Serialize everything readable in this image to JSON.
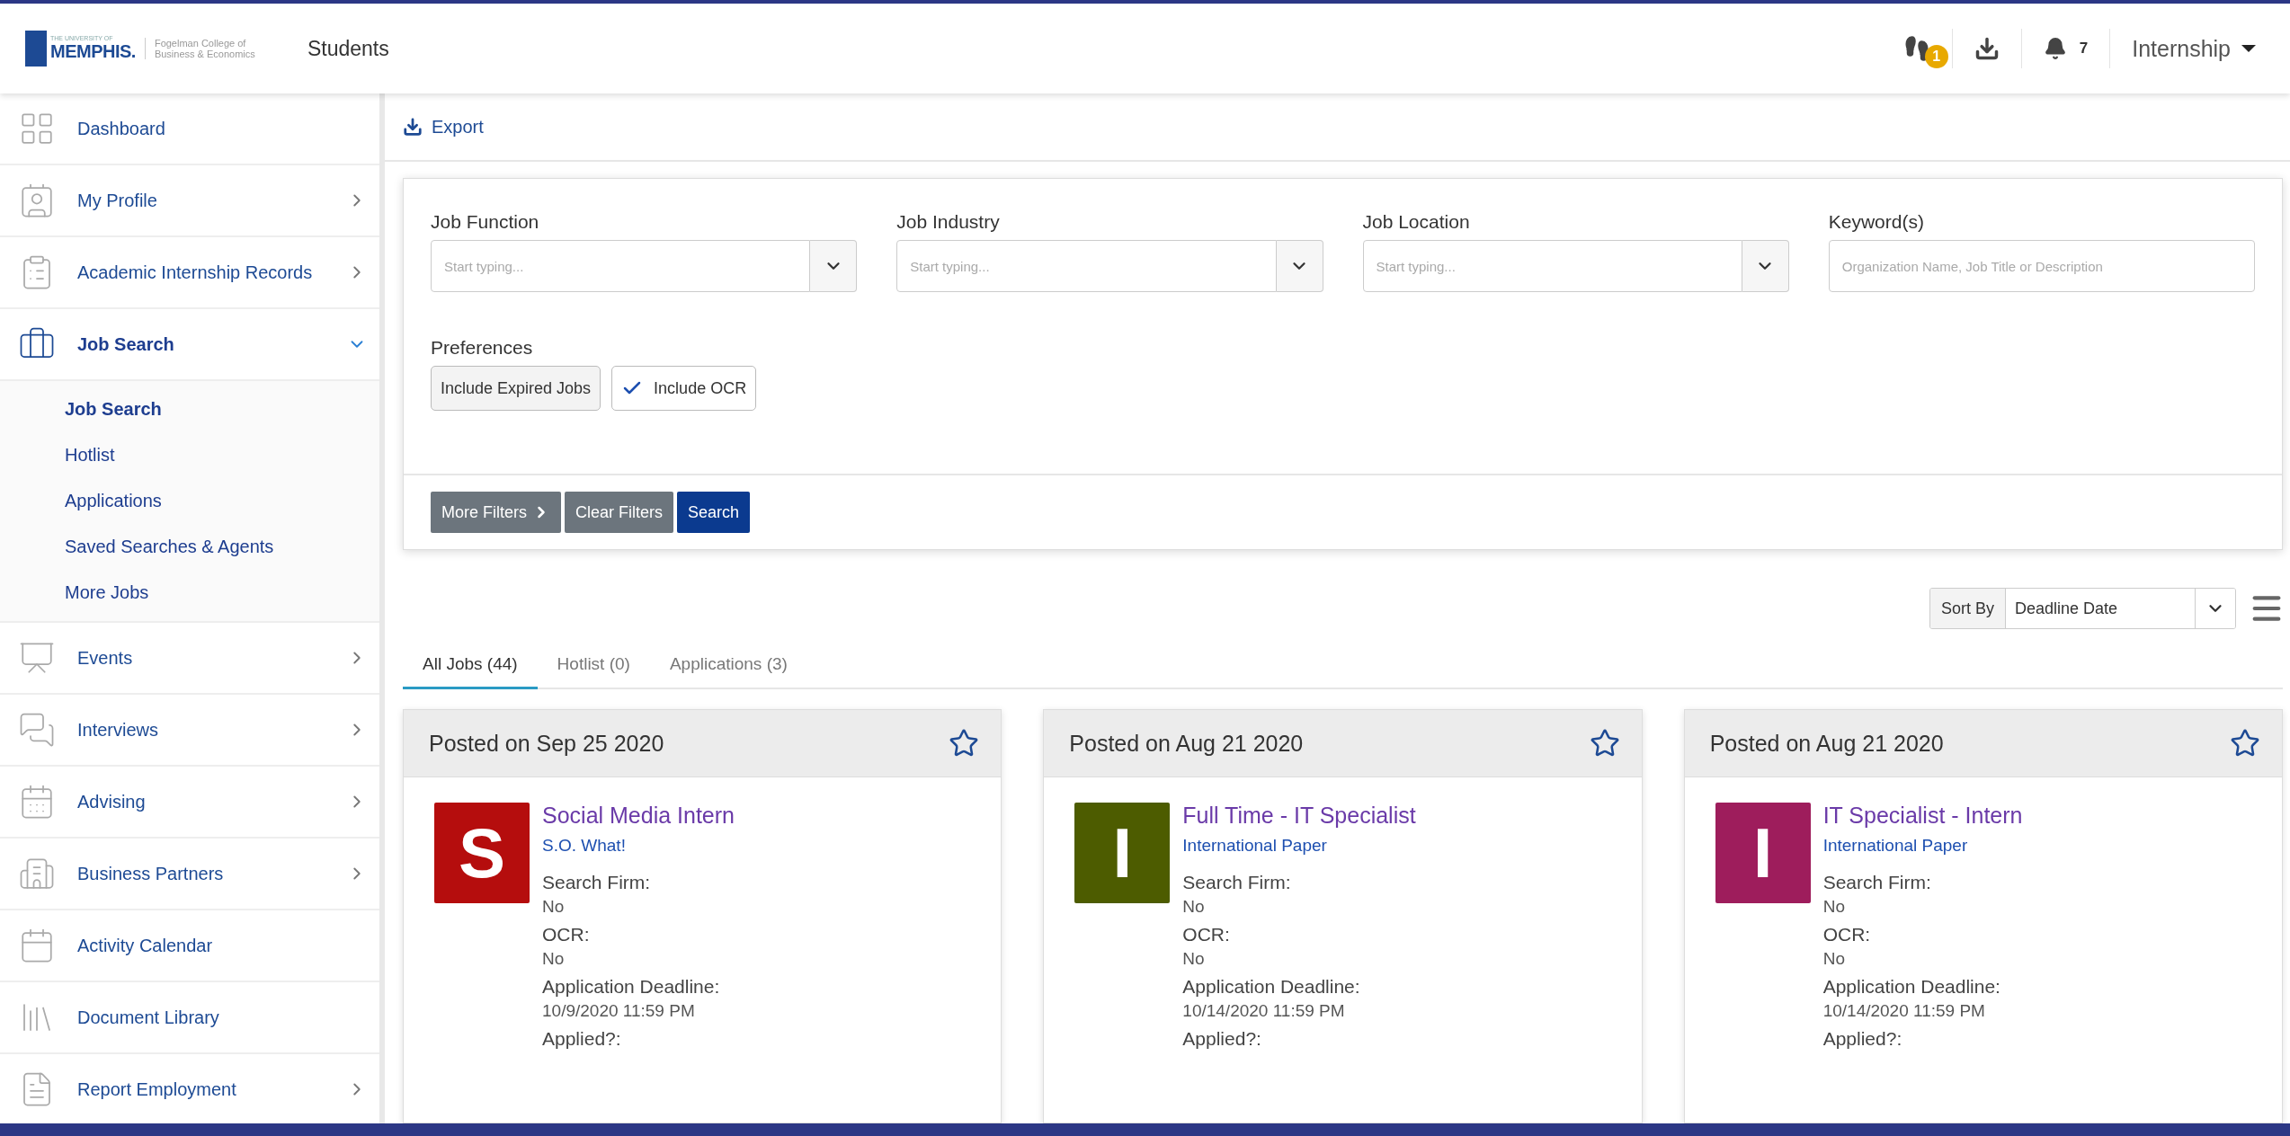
{
  "header": {
    "logo_small": "THE UNIVERSITY OF",
    "logo_main": "MEMPHIS.",
    "college": "Fogelman College of Business & Economics",
    "section": "Students",
    "badge_count": "1",
    "notification_count": "7",
    "role_menu": "Internship"
  },
  "sidebar": {
    "items": [
      {
        "label": "Dashboard",
        "kind": "link"
      },
      {
        "label": "My Profile",
        "kind": "group",
        "expanded": false
      },
      {
        "label": "Academic Internship Records",
        "kind": "group",
        "expanded": false
      },
      {
        "label": "Job Search",
        "kind": "group",
        "expanded": true,
        "children": [
          {
            "label": "Job Search",
            "selected": true
          },
          {
            "label": "Hotlist",
            "selected": false
          },
          {
            "label": "Applications",
            "selected": false
          },
          {
            "label": "Saved Searches & Agents",
            "selected": false
          },
          {
            "label": "More Jobs",
            "selected": false
          }
        ]
      },
      {
        "label": "Events",
        "kind": "group",
        "expanded": false
      },
      {
        "label": "Interviews",
        "kind": "group",
        "expanded": false
      },
      {
        "label": "Advising",
        "kind": "group",
        "expanded": false
      },
      {
        "label": "Business Partners",
        "kind": "group",
        "expanded": false
      },
      {
        "label": "Activity Calendar",
        "kind": "link"
      },
      {
        "label": "Document Library",
        "kind": "link"
      },
      {
        "label": "Report Employment",
        "kind": "group",
        "expanded": false
      }
    ]
  },
  "export_link": "Export",
  "filters": {
    "fields": [
      {
        "label": "Job Function",
        "placeholder": "Start typing...",
        "kind": "dropdown"
      },
      {
        "label": "Job Industry",
        "placeholder": "Start typing...",
        "kind": "dropdown"
      },
      {
        "label": "Job Location",
        "placeholder": "Start typing...",
        "kind": "dropdown"
      },
      {
        "label": "Keyword(s)",
        "placeholder": "Organization Name, Job Title or Description",
        "kind": "text"
      }
    ],
    "preferences_label": "Preferences",
    "preferences": [
      {
        "label": "Include Expired Jobs",
        "checked": false
      },
      {
        "label": "Include OCR",
        "checked": true
      }
    ],
    "buttons": [
      {
        "label": "More Filters",
        "kind": "more"
      },
      {
        "label": "Clear Filters",
        "kind": "secondary"
      },
      {
        "label": "Search",
        "kind": "primary"
      }
    ]
  },
  "sort": {
    "label": "Sort By",
    "value": "Deadline Date"
  },
  "tabs": [
    {
      "label": "All Jobs (44)",
      "selected": true
    },
    {
      "label": "Hotlist (0)",
      "selected": false
    },
    {
      "label": "Applications (3)",
      "selected": false
    }
  ],
  "jobs": [
    {
      "posted": "Posted on Sep 25 2020",
      "favorite": false,
      "letter": "S",
      "color": "#b50d0d",
      "title": "Social Media Intern",
      "company": "S.O. What!",
      "fields": [
        {
          "label": "Search Firm:",
          "value": "No"
        },
        {
          "label": "OCR:",
          "value": "No"
        },
        {
          "label": "Application Deadline:",
          "value": "10/9/2020 11:59 PM"
        },
        {
          "label": "Applied?:"
        }
      ]
    },
    {
      "posted": "Posted on Aug 21 2020",
      "favorite": false,
      "letter": "I",
      "color": "#4d5c00",
      "title": "Full Time - IT Specialist",
      "company": "International Paper",
      "fields": [
        {
          "label": "Search Firm:",
          "value": "No"
        },
        {
          "label": "OCR:",
          "value": "No"
        },
        {
          "label": "Application Deadline:",
          "value": "10/14/2020 11:59 PM"
        },
        {
          "label": "Applied?:"
        }
      ]
    },
    {
      "posted": "Posted on Aug 21 2020",
      "favorite": false,
      "letter": "I",
      "color": "#9e1d5c",
      "title": "IT Specialist - Intern",
      "company": "International Paper",
      "fields": [
        {
          "label": "Search Firm:",
          "value": "No"
        },
        {
          "label": "OCR:",
          "value": "No"
        },
        {
          "label": "Application Deadline:",
          "value": "10/14/2020 11:59 PM"
        },
        {
          "label": "Applied?:"
        }
      ]
    }
  ]
}
